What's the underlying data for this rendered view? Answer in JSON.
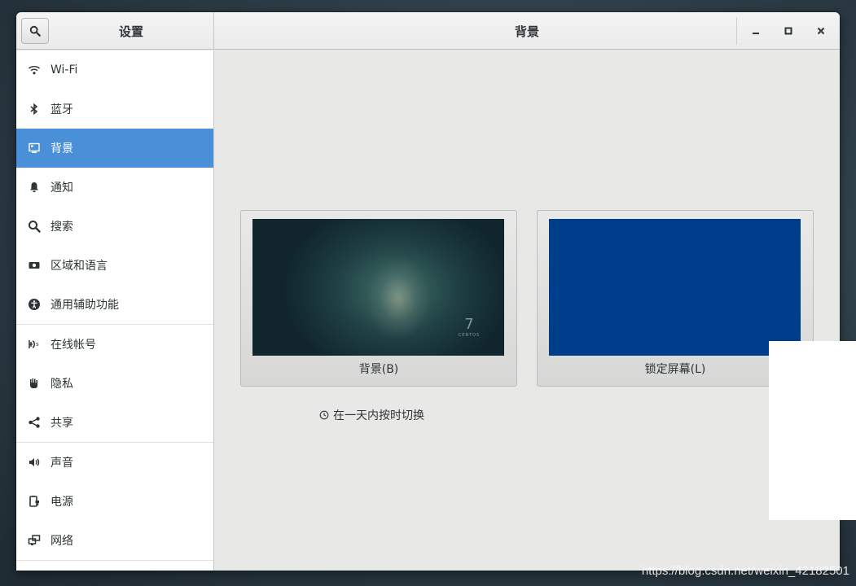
{
  "window": {
    "sidebar_title": "设置",
    "page_title": "背景",
    "controls": {
      "minimize": "–",
      "maximize": "□",
      "close": "✕"
    }
  },
  "sidebar": {
    "items": [
      {
        "label": "Wi-Fi",
        "icon": "wifi-icon"
      },
      {
        "label": "蓝牙",
        "icon": "bluetooth-icon"
      },
      {
        "label": "背景",
        "icon": "background-icon",
        "selected": true
      },
      {
        "label": "通知",
        "icon": "bell-icon"
      },
      {
        "label": "搜索",
        "icon": "search-icon"
      },
      {
        "label": "区域和语言",
        "icon": "region-icon"
      },
      {
        "label": "通用辅助功能",
        "icon": "accessibility-icon"
      },
      {
        "label": "在线帐号",
        "icon": "online-accounts-icon"
      },
      {
        "label": "隐私",
        "icon": "privacy-hand-icon"
      },
      {
        "label": "共享",
        "icon": "share-icon"
      },
      {
        "label": "声音",
        "icon": "speaker-icon"
      },
      {
        "label": "电源",
        "icon": "power-icon"
      },
      {
        "label": "网络",
        "icon": "network-icon"
      }
    ]
  },
  "content": {
    "background_card_label": "背景(B)",
    "lockscreen_card_label": "锁定屏幕(L)",
    "background_preview_mark": "7",
    "background_preview_brand": "CENTOS",
    "caption": "在一天内按时切换"
  },
  "colors": {
    "accent": "#4a90d9",
    "lockscreen": "#003d8a"
  },
  "watermark": "https://blog.csdn.net/weixin_42182501"
}
